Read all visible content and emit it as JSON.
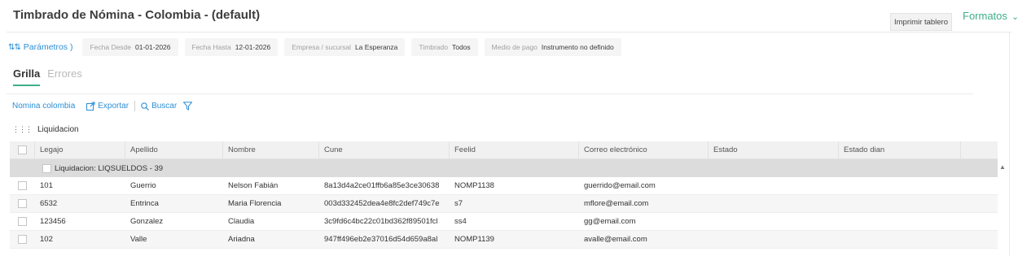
{
  "header": {
    "title": "Timbrado de Nómina - Colombia - (default)",
    "print_button": "Imprimir tablero",
    "formatos": "Formatos"
  },
  "params": {
    "link_label": "Parámetros )",
    "filters": [
      {
        "label": "Fecha Desde",
        "value": "01-01-2026"
      },
      {
        "label": "Fecha Hasta",
        "value": "12-01-2026"
      },
      {
        "label": "Empresa / sucursal",
        "value": "La Esperanza"
      },
      {
        "label": "Timbrado",
        "value": "Todos"
      },
      {
        "label": "Medio de pago",
        "value": "Instrumento no definido"
      }
    ]
  },
  "tabs": [
    {
      "label": "Grilla",
      "active": true
    },
    {
      "label": "Errores",
      "active": false
    }
  ],
  "toolbar": {
    "nomina": "Nomina colombia",
    "export": "Exportar",
    "search": "Buscar"
  },
  "grouping": {
    "label": "Liquidacion"
  },
  "table": {
    "columns": [
      "Legajo",
      "Apellido",
      "Nombre",
      "Cune",
      "Feelid",
      "Correo electrónico",
      "Estado",
      "Estado dian"
    ],
    "group_label": "Liquidacion: LIQSUELDOS - 39",
    "rows": [
      [
        "101",
        "Guerrio",
        "Nelson Fabián",
        "8a13d4a2ce01ffb6a85e3ce30638",
        "NOMP1138",
        "guerrido@email.com",
        "",
        ""
      ],
      [
        "6532",
        "Entrinca",
        "Maria Florencia",
        "003d332452dea4e8fc2def749c7e",
        "s7",
        "mflore@email.com",
        "",
        ""
      ],
      [
        "123456",
        "Gonzalez",
        "Claudia",
        "3c9fd6c4bc22c01bd362f89501fcl",
        "ss4",
        "gg@email.com",
        "",
        ""
      ],
      [
        "102",
        "Valle",
        "Ariadna",
        "947ff496eb2e37016d54d659a8al",
        "NOMP1139",
        "avalle@email.com",
        "",
        ""
      ]
    ]
  },
  "colors": {
    "accent_green": "#3fae8a",
    "link_blue": "#2c8fd6"
  }
}
